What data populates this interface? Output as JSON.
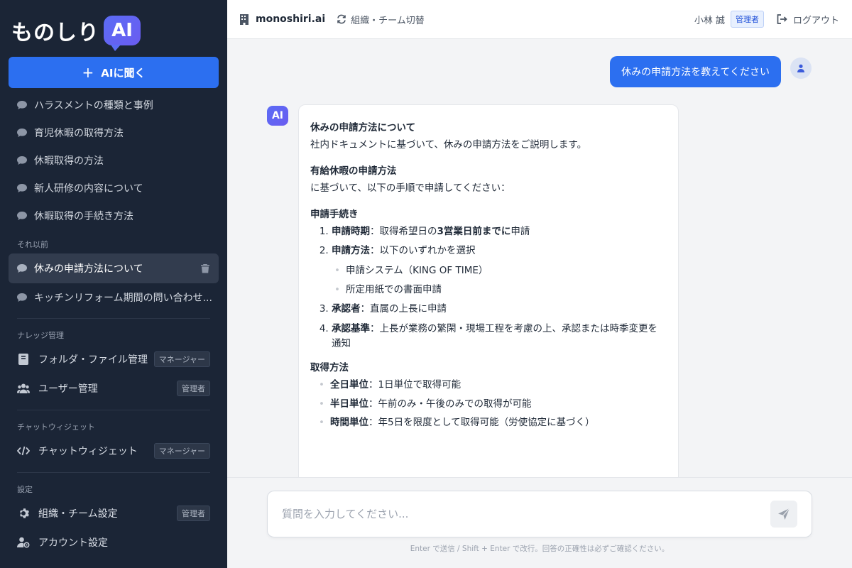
{
  "sidebar": {
    "logo_text": "ものしり",
    "logo_badge": "AI",
    "ask_label": "AIに聞く",
    "history": [
      {
        "label": "ハラスメントの種類と事例"
      },
      {
        "label": "育児休暇の取得方法"
      },
      {
        "label": "休暇取得の方法"
      },
      {
        "label": "新人研修の内容について"
      },
      {
        "label": "休暇取得の手続き方法"
      }
    ],
    "older_title": "それ以前",
    "older": [
      {
        "label": "休みの申請方法について"
      },
      {
        "label": "キッチンリフォーム期間の問い合わせ..."
      }
    ],
    "knowledge_title": "ナレッジ管理",
    "knowledge_items": [
      {
        "label": "フォルダ・ファイル管理",
        "role": "マネージャー"
      },
      {
        "label": "ユーザー管理",
        "role": "管理者"
      }
    ],
    "widget_title": "チャットウィジェット",
    "widget_item": {
      "label": "チャットウィジェット",
      "role": "マネージャー"
    },
    "settings_title": "設定",
    "settings_items": [
      {
        "label": "組織・チーム設定",
        "role": "管理者"
      },
      {
        "label": "アカウント設定"
      }
    ]
  },
  "topbar": {
    "brand": "monoshiri.ai",
    "switch_label": "組織・チーム切替",
    "user_name": "小林 誠",
    "user_role": "管理者",
    "logout_label": "ログアウト"
  },
  "chat": {
    "user_message": "休みの申請方法を教えてください",
    "ai_avatar": "AI",
    "answer": {
      "title": "休みの申請方法について",
      "intro": "社内ドキュメントに基づいて、休みの申請方法をご説明します。",
      "section1": "有給休暇の申請方法",
      "section1_text": "に基づいて、以下の手順で申請してください：",
      "section2": "申請手続き",
      "step1_label": "申請時期",
      "step1_pre": "：取得希望日の",
      "step1_bold": "3営業日前までに",
      "step1_post": "申請",
      "step2_label": "申請方法",
      "step2_text": "：以下のいずれかを選択",
      "step2_opt1": "申請システム（KING OF TIME）",
      "step2_opt2": "所定用紙での書面申請",
      "step3_label": "承認者",
      "step3_text": "：直属の上長に申請",
      "step4_label": "承認基準",
      "step4_text": "：上長が業務の繁閑・現場工程を考慮の上、承認または時季変更を通知",
      "section3": "取得方法",
      "m1_label": "全日単位",
      "m1_text": "：1日単位で取得可能",
      "m2_label": "半日単位",
      "m2_text": "：午前のみ・午後のみでの取得が可能",
      "m3_label": "時間単位",
      "m3_text": "：年5日を限度として取得可能（労使協定に基づく）"
    }
  },
  "input": {
    "placeholder": "質問を入力してください...",
    "hint": "Enter で送信 / Shift + Enter で改行。回答の正確性は必ずご確認ください。"
  }
}
